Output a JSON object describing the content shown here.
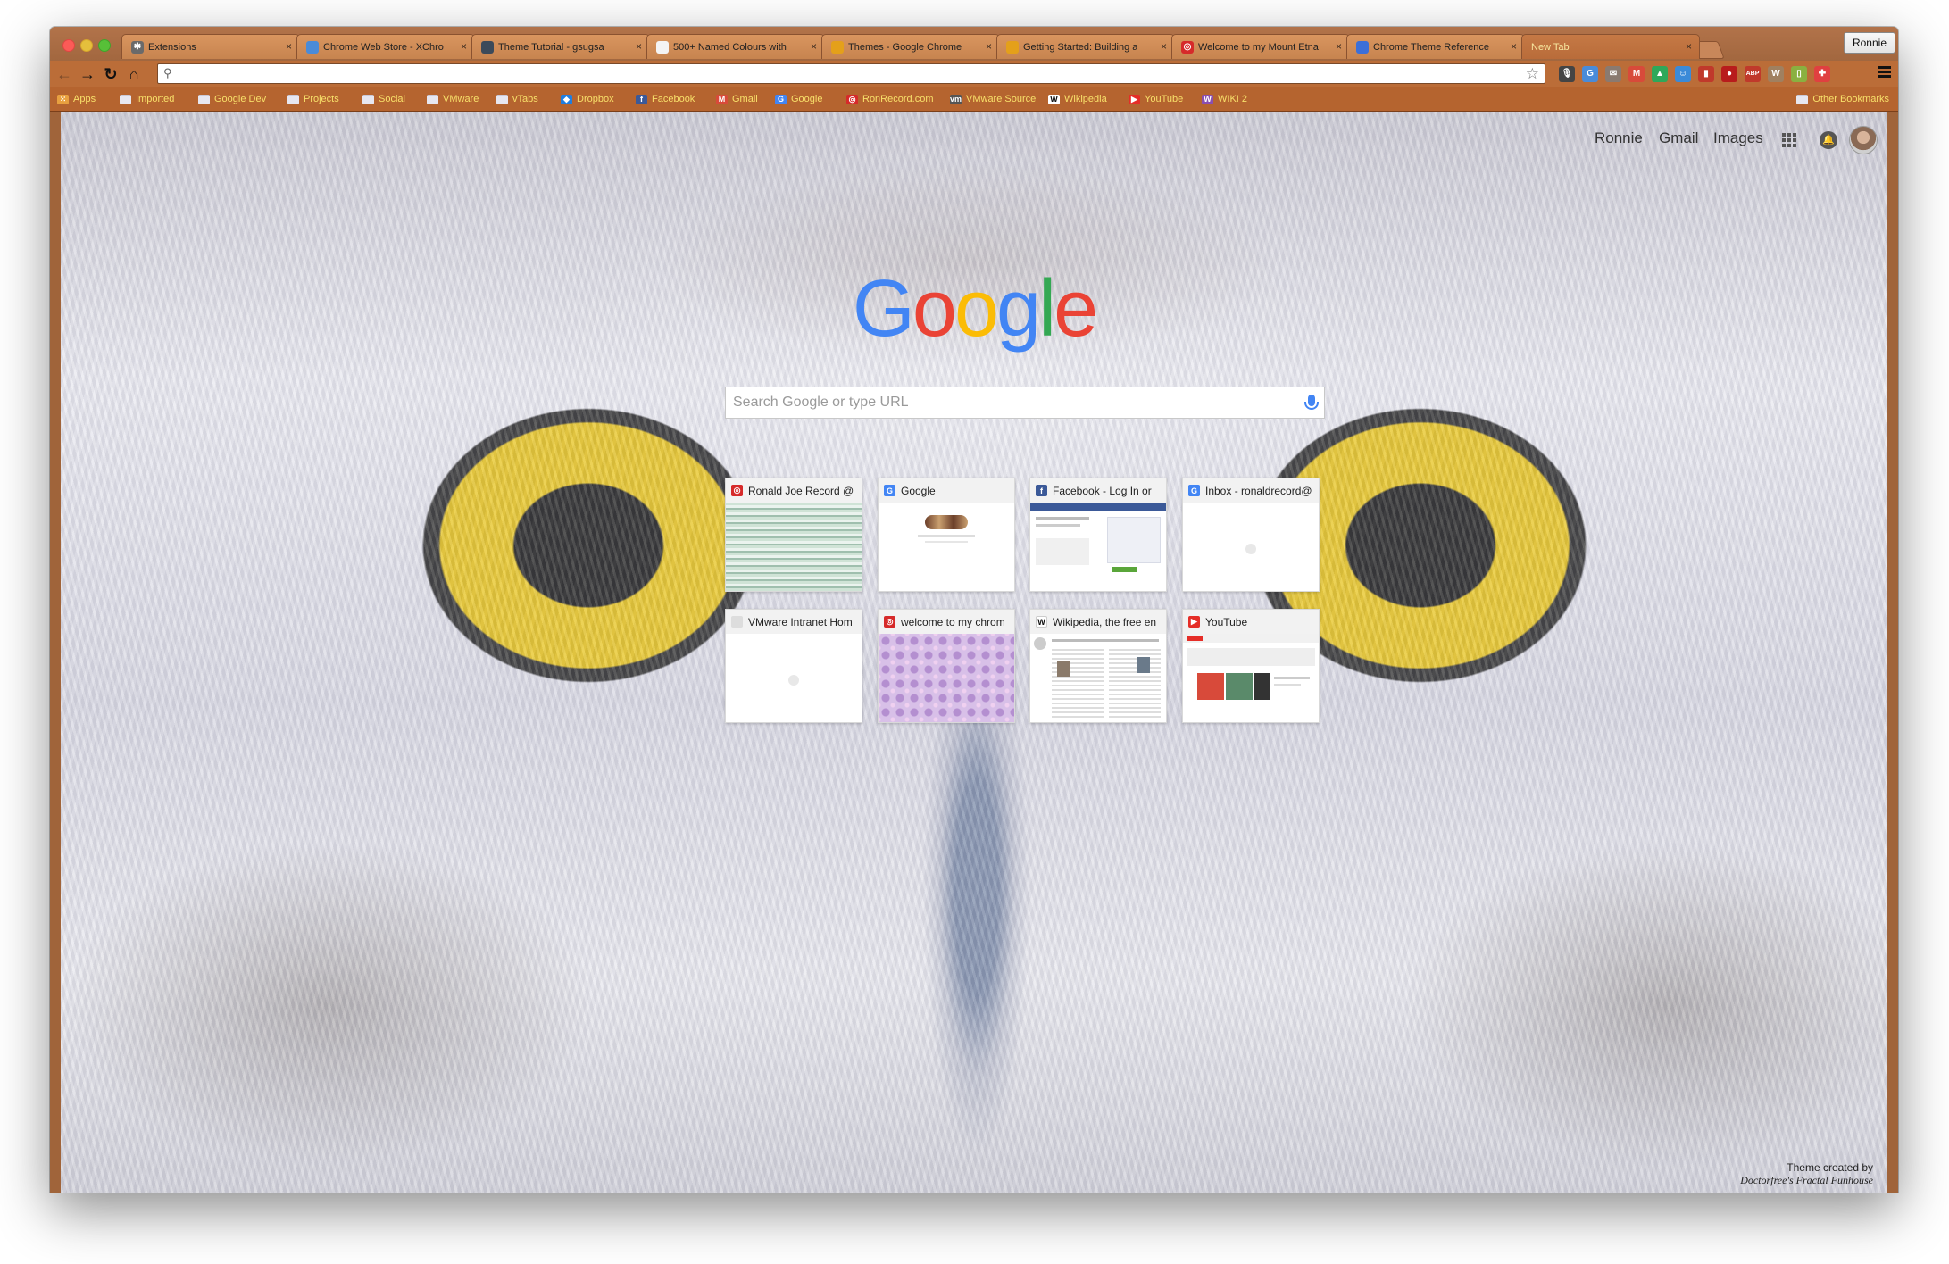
{
  "tabs": [
    {
      "title": "Extensions",
      "favicon": "puzzle-icon",
      "color": "#6a6a6a",
      "glyph": "✱"
    },
    {
      "title": "Chrome Web Store - XChro",
      "favicon": "chrome-store-icon",
      "color": "#4a8bd8",
      "glyph": ""
    },
    {
      "title": "Theme Tutorial - gsugsa",
      "favicon": "doc-icon",
      "color": "#3b4a5a",
      "glyph": ""
    },
    {
      "title": "500+ Named Colours with",
      "favicon": "page-icon",
      "color": "#f4f4f4",
      "glyph": ""
    },
    {
      "title": "Themes - Google Chrome",
      "favicon": "chrome-icon",
      "color": "#e4a01a",
      "glyph": ""
    },
    {
      "title": "Getting Started: Building a",
      "favicon": "chrome-icon",
      "color": "#e4a01a",
      "glyph": ""
    },
    {
      "title": "Welcome to my Mount Etna",
      "favicon": "target-icon",
      "color": "#d62a2a",
      "glyph": "◎"
    },
    {
      "title": "Chrome Theme Reference",
      "favicon": "doc-icon",
      "color": "#3b6fd8",
      "glyph": ""
    },
    {
      "title": "New Tab",
      "favicon": "",
      "color": "",
      "glyph": "",
      "active": true
    }
  ],
  "profile_name": "Ronnie",
  "bookmarks": [
    {
      "label": "Apps",
      "icon": "apps-grid-icon",
      "color": "#e8a040",
      "glyph": "⁙"
    },
    {
      "label": "Imported",
      "icon": "folder-icon",
      "folder": true
    },
    {
      "label": "Google Dev",
      "icon": "folder-icon",
      "folder": true
    },
    {
      "label": "Projects",
      "icon": "folder-icon",
      "folder": true
    },
    {
      "label": "Social",
      "icon": "folder-icon",
      "folder": true
    },
    {
      "label": "VMware",
      "icon": "folder-icon",
      "folder": true
    },
    {
      "label": "vTabs",
      "icon": "folder-icon",
      "folder": true
    },
    {
      "label": "Dropbox",
      "icon": "dropbox-icon",
      "color": "#1f7ee0",
      "glyph": "◆"
    },
    {
      "label": "Facebook",
      "icon": "facebook-icon",
      "color": "#3b5998",
      "glyph": "f"
    },
    {
      "label": "Gmail",
      "icon": "gmail-icon",
      "color": "#d84a3a",
      "glyph": "M"
    },
    {
      "label": "Google",
      "icon": "google-icon",
      "color": "#4285f4",
      "glyph": "G"
    },
    {
      "label": "RonRecord.com",
      "icon": "target-icon",
      "color": "#d62a2a",
      "glyph": "◎"
    },
    {
      "label": "VMware Source",
      "icon": "vm-icon",
      "color": "#555555",
      "glyph": "vm"
    },
    {
      "label": "Wikipedia",
      "icon": "wikipedia-icon",
      "color": "#ffffff",
      "glyph": "W"
    },
    {
      "label": "YouTube",
      "icon": "youtube-icon",
      "color": "#e52d27",
      "glyph": "▶"
    },
    {
      "label": "WIKI 2",
      "icon": "wiki2-icon",
      "color": "#8a4fb0",
      "glyph": "W"
    }
  ],
  "other_bookmarks": "Other Bookmarks",
  "omnibox_value": "",
  "extensions": [
    {
      "name": "mic-icon",
      "color": "#444",
      "glyph": "🎙"
    },
    {
      "name": "translate-icon",
      "color": "#4a8bd8",
      "glyph": "G"
    },
    {
      "name": "mail-icon",
      "color": "#8a7a70",
      "glyph": "✉"
    },
    {
      "name": "gmail-checker-icon",
      "color": "#d84a3a",
      "glyph": "M"
    },
    {
      "name": "drive-icon",
      "color": "#2ea85a",
      "glyph": "▲"
    },
    {
      "name": "hangouts-icon",
      "color": "#3b8ad8",
      "glyph": "☺"
    },
    {
      "name": "pdf-icon",
      "color": "#c0392b",
      "glyph": "▮"
    },
    {
      "name": "lastpass-icon",
      "color": "#b81c1c",
      "glyph": "●"
    },
    {
      "name": "adblock-icon",
      "color": "#c0392b",
      "glyph": "ABP"
    },
    {
      "name": "wiki-ext-icon",
      "color": "#a08060",
      "glyph": "W"
    },
    {
      "name": "battery-icon",
      "color": "#8ab040",
      "glyph": "▯"
    },
    {
      "name": "extension-red-icon",
      "color": "#e04040",
      "glyph": "✚"
    }
  ],
  "google_bar": {
    "user": "Ronnie",
    "gmail": "Gmail",
    "images": "Images"
  },
  "logo": {
    "letters": [
      "G",
      "o",
      "o",
      "g",
      "l",
      "e"
    ],
    "colors": [
      "#4285f4",
      "#ea4335",
      "#fbbc05",
      "#4285f4",
      "#34a853",
      "#ea4335"
    ]
  },
  "search": {
    "placeholder": "Search Google or type URL"
  },
  "most_visited": [
    {
      "title": "Ronald Joe Record @",
      "favicon": "target-icon",
      "color": "#d62a2a",
      "glyph": "◎",
      "thumb": "record"
    },
    {
      "title": "Google",
      "favicon": "google-icon",
      "color": "#4285f4",
      "glyph": "G",
      "thumb": "google"
    },
    {
      "title": "Facebook - Log In or",
      "favicon": "facebook-icon",
      "color": "#3b5998",
      "glyph": "f",
      "thumb": "facebook"
    },
    {
      "title": "Inbox - ronaldrecord@",
      "favicon": "google-icon",
      "color": "#4285f4",
      "glyph": "G",
      "thumb": "blank"
    },
    {
      "title": "VMware Intranet Hom",
      "favicon": "page-icon",
      "color": "#dddddd",
      "glyph": "",
      "thumb": "blank"
    },
    {
      "title": "welcome to my chrom",
      "favicon": "target-icon",
      "color": "#d62a2a",
      "glyph": "◎",
      "thumb": "pattern"
    },
    {
      "title": "Wikipedia, the free en",
      "favicon": "wikipedia-icon",
      "color": "#ffffff",
      "glyph": "W",
      "thumb": "wikipedia"
    },
    {
      "title": "YouTube",
      "favicon": "youtube-icon",
      "color": "#e52d27",
      "glyph": "▶",
      "thumb": "youtube"
    }
  ],
  "theme_credit": {
    "line1": "Theme created by",
    "line2": "Doctorfree's Fractal Funhouse"
  }
}
